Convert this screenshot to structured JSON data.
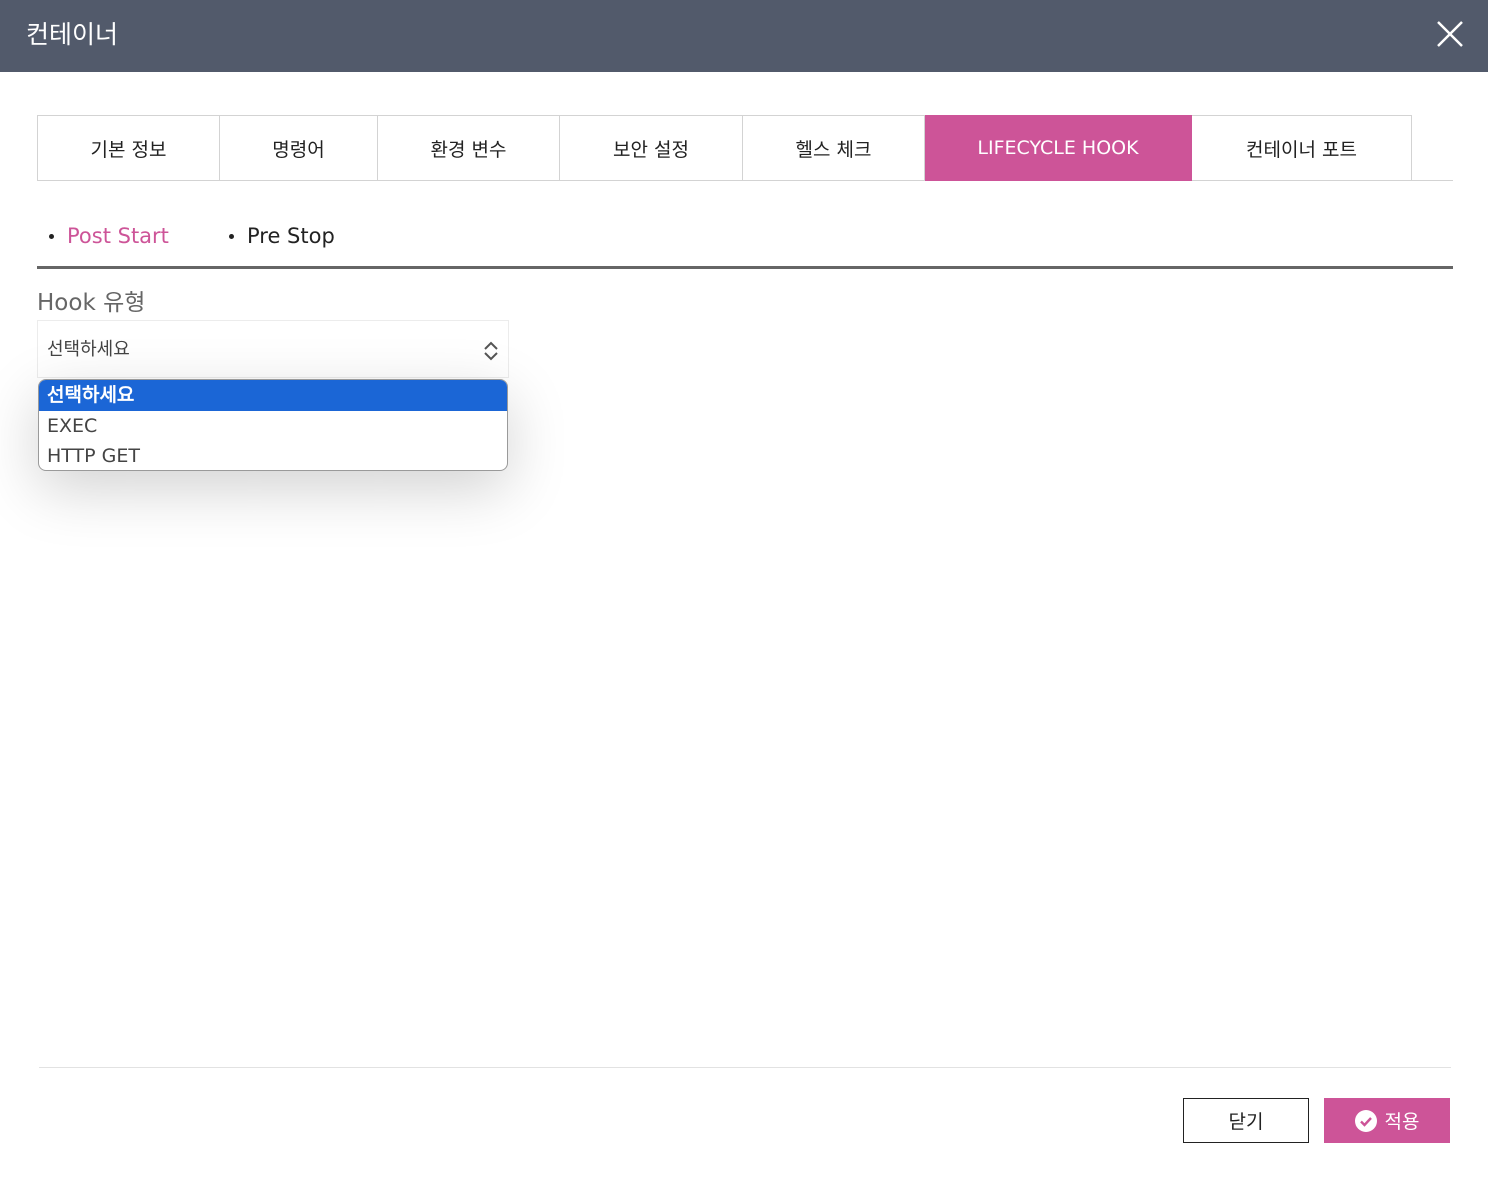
{
  "header": {
    "title": "컨테이너",
    "close_icon": "close-icon"
  },
  "tabs": [
    {
      "label": "기본 정보",
      "active": false
    },
    {
      "label": "명령어",
      "active": false
    },
    {
      "label": "환경 변수",
      "active": false
    },
    {
      "label": "보안 설정",
      "active": false
    },
    {
      "label": "헬스 체크",
      "active": false
    },
    {
      "label": "LIFECYCLE HOOK",
      "active": true
    },
    {
      "label": "컨테이너 포트",
      "active": false
    }
  ],
  "subtabs": [
    {
      "label": "Post Start",
      "active": true
    },
    {
      "label": "Pre Stop",
      "active": false
    }
  ],
  "form": {
    "hook_type_label": "Hook 유형",
    "hook_type_value": "선택하세요",
    "options": [
      "선택하세요",
      "EXEC",
      "HTTP GET"
    ],
    "selected_index": 0
  },
  "footer": {
    "close_label": "닫기",
    "apply_label": "적용"
  },
  "colors": {
    "header_bg": "#525a6b",
    "accent": "#cd5498",
    "option_highlight": "#1b66d6"
  }
}
